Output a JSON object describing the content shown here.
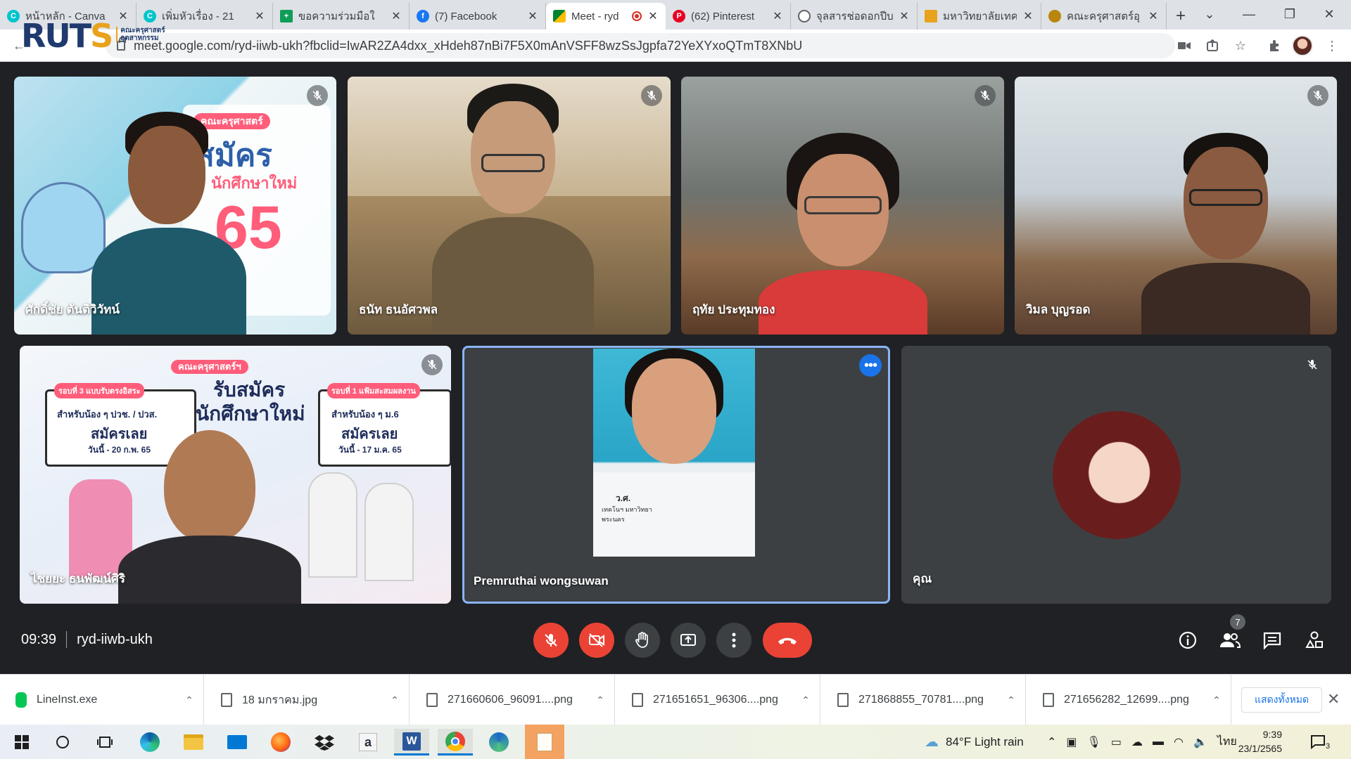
{
  "browser": {
    "tabs": [
      {
        "title": "หน้าหลัก - Canva",
        "favicon": "canva-icon",
        "color": "#00c4cc"
      },
      {
        "title": "เพิ่มหัวเรื่อง - 21",
        "favicon": "canva-icon",
        "color": "#00c4cc"
      },
      {
        "title": "ขอความร่วมมือใ",
        "favicon": "sheets-icon",
        "color": "#0f9d58"
      },
      {
        "title": "(7) Facebook",
        "favicon": "facebook-icon",
        "color": "#1877f2"
      },
      {
        "title": "Meet - ryd",
        "favicon": "meet-icon",
        "color": "#00832d",
        "active": true,
        "recording": true
      },
      {
        "title": "(62) Pinterest",
        "favicon": "pinterest-icon",
        "color": "#e60023"
      },
      {
        "title": "จุลสารช่อดอกปีบ",
        "favicon": "globe-icon",
        "color": "#5f6368"
      },
      {
        "title": "มหาวิทยาลัยเทค",
        "favicon": "university-icon",
        "color": "#e8a21c"
      },
      {
        "title": "คณะครุศาสตร์อุ",
        "favicon": "faculty-icon",
        "color": "#b8860b"
      }
    ],
    "url": "meet.google.com/ryd-iiwb-ukh?fbclid=IwAR2ZA4dxx_xHdeh87nBi7F5X0mAnVSFF8wzSsJgpfa72YeXYxoQTmT8XNbU"
  },
  "logo": {
    "text_main": "RUT",
    "text_s": "S",
    "sub1": "คณะครุศาสตร์",
    "sub2": "อุตสาหกรรม"
  },
  "participants": [
    {
      "name": "ศักดิ์ชัย ตันติวิวัทน์",
      "muted": true
    },
    {
      "name": "ธนัท ธนอัศวพล",
      "muted": true
    },
    {
      "name": "ฤทัย ประทุมทอง",
      "muted": true
    },
    {
      "name": "วิมล บุญรอด",
      "muted": true
    },
    {
      "name": "ไชยยะ ธนพัฒน์ศิริ",
      "muted": true
    },
    {
      "name": "Premruthai wongsuwan",
      "muted": false,
      "speaking": true
    },
    {
      "name": "คุณ",
      "muted": true
    }
  ],
  "poster1": {
    "badge": "คณะครุศาสตร์",
    "line1": "สมัคร",
    "line2": "นักศึกษาใหม่",
    "year": "65"
  },
  "poster2": {
    "badge": "คณะครุศาสตร์ฯ",
    "line1": "รับสมัคร",
    "line2": "นักศึกษาใหม่",
    "left_tag": "รอบที่ 3 แบบรับตรงอิสระ",
    "left_text1": "สำหรับน้อง ๆ ปวช. / ปวส.",
    "left_text2": "สมัครเลย",
    "left_date": "วันนี้ - 20 ก.พ. 65",
    "right_tag": "รอบที่ 1 แฟ้มสะสมผลงาน",
    "right_text1": "สำหรับน้อง ๆ ม.6",
    "right_text2": "สมัครเลย",
    "right_date": "วันนี้ - 17 ม.ค. 65"
  },
  "shirt_text": {
    "line1": "ว.ศ.",
    "line2": "เทคโนฯ มหาวิทยา",
    "line3": "พระนคร"
  },
  "meeting": {
    "time": "09:39",
    "code": "ryd-iiwb-ukh",
    "participant_count": "7"
  },
  "downloads": {
    "items": [
      {
        "name": "LineInst.exe",
        "type": "exe"
      },
      {
        "name": "18 มกราคม.jpg",
        "type": "file"
      },
      {
        "name": "271660606_96091....png",
        "type": "file"
      },
      {
        "name": "271651651_96306....png",
        "type": "file"
      },
      {
        "name": "271868855_70781....png",
        "type": "file"
      },
      {
        "name": "271656282_12699....png",
        "type": "file"
      }
    ],
    "show_all": "แสดงทั้งหมด"
  },
  "taskbar": {
    "weather": "84°F  Light rain",
    "lang": "ไทย",
    "time": "9:39",
    "date": "23/1/2565",
    "notifications": "3"
  }
}
